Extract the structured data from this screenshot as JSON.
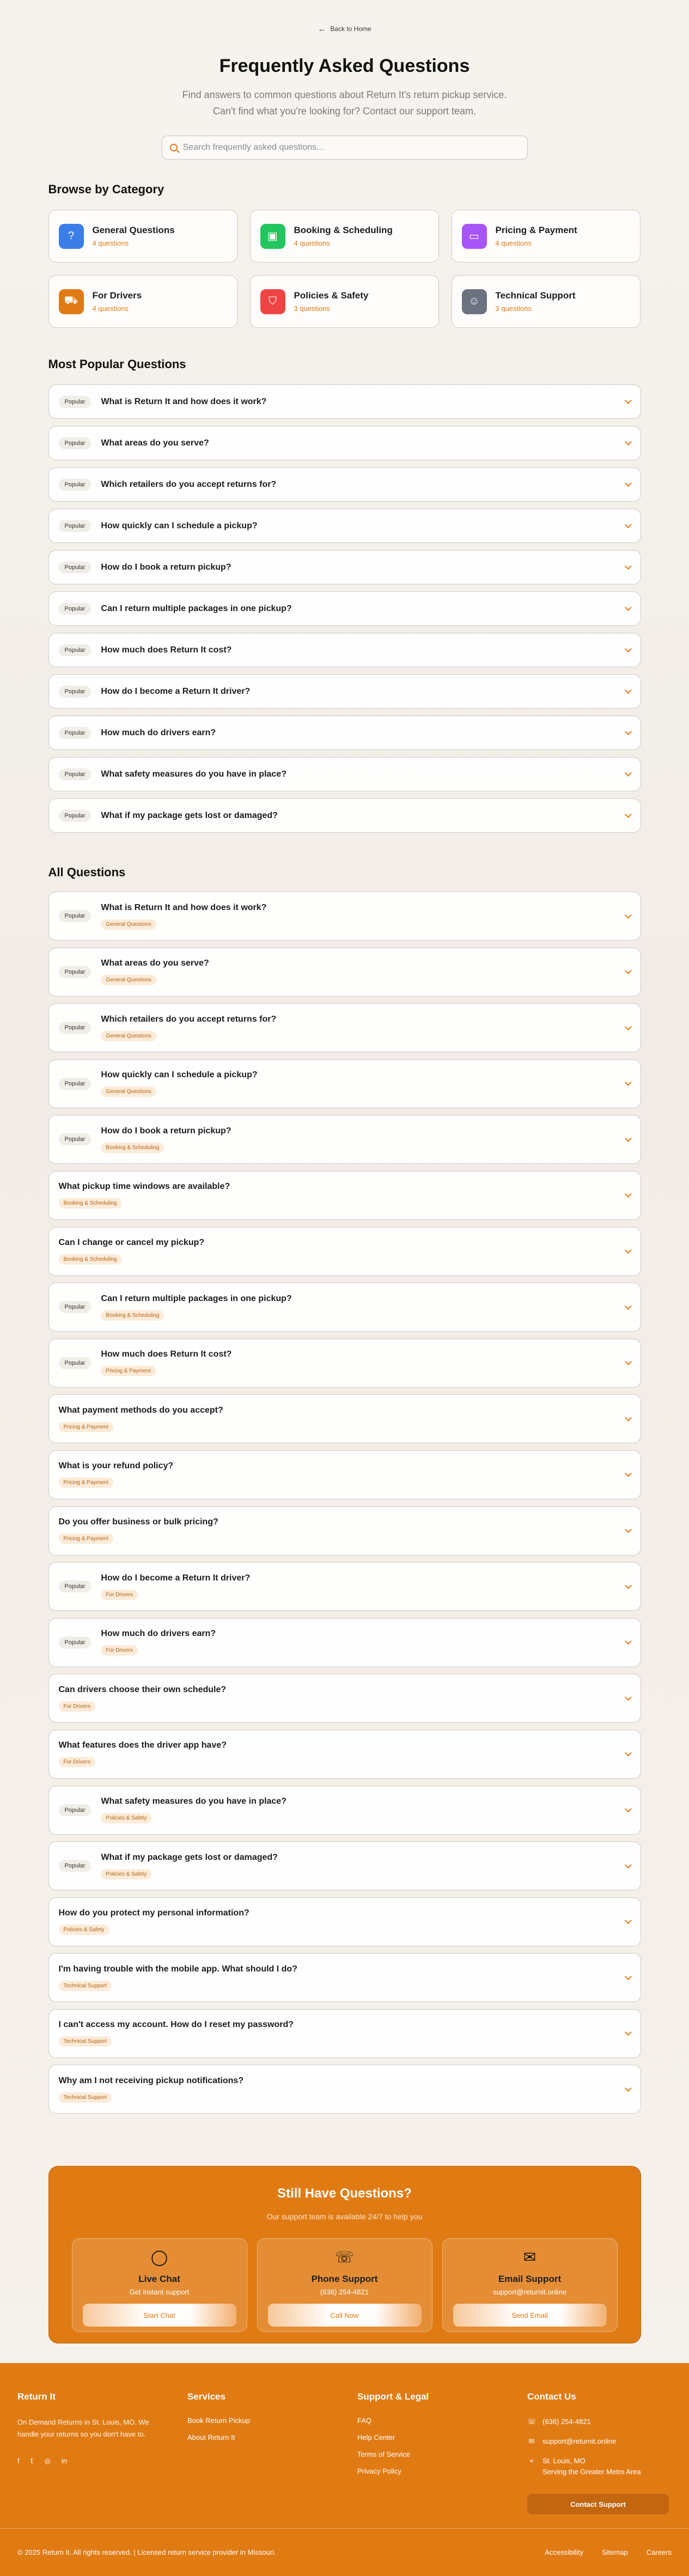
{
  "header": {
    "back_label": "Back to Home",
    "title": "Frequently Asked Questions",
    "subtitle_line1": "Find answers to common questions about Return It's return pickup service.",
    "subtitle_line2": "Can't find what you're looking for? Contact our support team.",
    "search_placeholder": "Search frequently asked questions..."
  },
  "categories": {
    "title": "Browse by Category",
    "items": [
      {
        "name": "General Questions",
        "count": "4 questions",
        "icon": "help-circle-icon",
        "color": "#3b7ee8"
      },
      {
        "name": "Booking & Scheduling",
        "count": "4 questions",
        "icon": "box-icon",
        "color": "#22c55e"
      },
      {
        "name": "Pricing & Payment",
        "count": "4 questions",
        "icon": "credit-card-icon",
        "color": "#a855f7"
      },
      {
        "name": "For Drivers",
        "count": "4 questions",
        "icon": "truck-icon",
        "color": "#e07b14"
      },
      {
        "name": "Policies & Safety",
        "count": "3 questions",
        "icon": "shield-icon",
        "color": "#ef4444"
      },
      {
        "name": "Technical Support",
        "count": "3 questions",
        "icon": "user-icon",
        "color": "#6b7280"
      }
    ]
  },
  "popular": {
    "title": "Most Popular Questions",
    "badge": "Popular",
    "items": [
      "What is Return It and how does it work?",
      "What areas do you serve?",
      "Which retailers do you accept returns for?",
      "How quickly can I schedule a pickup?",
      "How do I book a return pickup?",
      "Can I return multiple packages in one pickup?",
      "How much does Return It cost?",
      "How do I become a Return It driver?",
      "How much do drivers earn?",
      "What safety measures do you have in place?",
      "What if my package gets lost or damaged?"
    ]
  },
  "all": {
    "title": "All Questions",
    "badge": "Popular",
    "items": [
      {
        "q": "What is Return It and how does it work?",
        "cat": "General Questions",
        "popular": true
      },
      {
        "q": "What areas do you serve?",
        "cat": "General Questions",
        "popular": true
      },
      {
        "q": "Which retailers do you accept returns for?",
        "cat": "General Questions",
        "popular": true
      },
      {
        "q": "How quickly can I schedule a pickup?",
        "cat": "General Questions",
        "popular": true
      },
      {
        "q": "How do I book a return pickup?",
        "cat": "Booking & Scheduling",
        "popular": true
      },
      {
        "q": "What pickup time windows are available?",
        "cat": "Booking & Scheduling",
        "popular": false
      },
      {
        "q": "Can I change or cancel my pickup?",
        "cat": "Booking & Scheduling",
        "popular": false
      },
      {
        "q": "Can I return multiple packages in one pickup?",
        "cat": "Booking & Scheduling",
        "popular": true
      },
      {
        "q": "How much does Return It cost?",
        "cat": "Pricing & Payment",
        "popular": true
      },
      {
        "q": "What payment methods do you accept?",
        "cat": "Pricing & Payment",
        "popular": false
      },
      {
        "q": "What is your refund policy?",
        "cat": "Pricing & Payment",
        "popular": false
      },
      {
        "q": "Do you offer business or bulk pricing?",
        "cat": "Pricing & Payment",
        "popular": false
      },
      {
        "q": "How do I become a Return It driver?",
        "cat": "For Drivers",
        "popular": true
      },
      {
        "q": "How much do drivers earn?",
        "cat": "For Drivers",
        "popular": true
      },
      {
        "q": "Can drivers choose their own schedule?",
        "cat": "For Drivers",
        "popular": false
      },
      {
        "q": "What features does the driver app have?",
        "cat": "For Drivers",
        "popular": false
      },
      {
        "q": "What safety measures do you have in place?",
        "cat": "Policies & Safety",
        "popular": true
      },
      {
        "q": "What if my package gets lost or damaged?",
        "cat": "Policies & Safety",
        "popular": true
      },
      {
        "q": "How do you protect my personal information?",
        "cat": "Policies & Safety",
        "popular": false
      },
      {
        "q": "I'm having trouble with the mobile app. What should I do?",
        "cat": "Technical Support",
        "popular": false
      },
      {
        "q": "I can't access my account. How do I reset my password?",
        "cat": "Technical Support",
        "popular": false
      },
      {
        "q": "Why am I not receiving pickup notifications?",
        "cat": "Technical Support",
        "popular": false
      }
    ]
  },
  "support": {
    "title": "Still Have Questions?",
    "subtitle": "Our support team is available 24/7 to help you",
    "cards": [
      {
        "name": "Live Chat",
        "value": "Get instant support",
        "button": "Start Chat",
        "icon": "chat-icon"
      },
      {
        "name": "Phone Support",
        "value": "(636) 254-4821",
        "button": "Call Now",
        "icon": "phone-icon"
      },
      {
        "name": "Email Support",
        "value": "support@returnit.online",
        "button": "Send Email",
        "icon": "mail-icon"
      }
    ]
  },
  "footer": {
    "brand": "Return It",
    "description": "On Demand Returns in St. Louis, MO. We handle your returns so you don't have to.",
    "social": [
      "facebook-icon",
      "twitter-icon",
      "instagram-icon",
      "linkedin-icon"
    ],
    "services_title": "Services",
    "services": [
      "Book Return Pickup",
      "About Return It"
    ],
    "support_title": "Support & Legal",
    "support_links": [
      "FAQ",
      "Help Center",
      "Terms of Service",
      "Privacy Policy"
    ],
    "contact_title": "Contact Us",
    "phone": "(636) 254-4821",
    "email": "support@returnit.online",
    "location_line1": "St. Louis, MO",
    "location_line2": "Serving the Greater Metro Area",
    "contact_button": "Contact Support",
    "copyright": "© 2025 Return It. All rights reserved. | Licensed return service provider in Missouri.",
    "legal": [
      "Accessibility",
      "Sitemap",
      "Careers"
    ]
  }
}
